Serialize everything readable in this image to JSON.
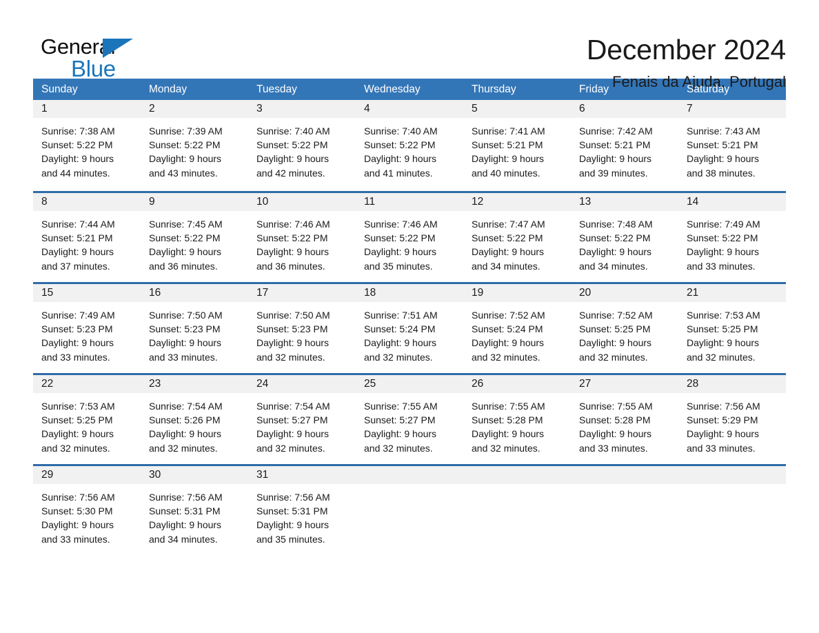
{
  "brand": {
    "logo_primary": "General",
    "logo_secondary": "Blue",
    "logo_mark": "triangle-icon",
    "accent_color": "#1b75bb"
  },
  "header": {
    "title": "December 2024",
    "subtitle": "Fenais da Ajuda, Portugal"
  },
  "colors": {
    "header_bar": "#3376b8",
    "row_divider": "#2e6ca8",
    "day_band": "#f1f1f1",
    "text": "#1a1a1a"
  },
  "weekday_headers": [
    "Sunday",
    "Monday",
    "Tuesday",
    "Wednesday",
    "Thursday",
    "Friday",
    "Saturday"
  ],
  "weeks": [
    [
      {
        "day": "1",
        "sunrise": "Sunrise: 7:38 AM",
        "sunset": "Sunset: 5:22 PM",
        "daylight1": "Daylight: 9 hours",
        "daylight2": "and 44 minutes."
      },
      {
        "day": "2",
        "sunrise": "Sunrise: 7:39 AM",
        "sunset": "Sunset: 5:22 PM",
        "daylight1": "Daylight: 9 hours",
        "daylight2": "and 43 minutes."
      },
      {
        "day": "3",
        "sunrise": "Sunrise: 7:40 AM",
        "sunset": "Sunset: 5:22 PM",
        "daylight1": "Daylight: 9 hours",
        "daylight2": "and 42 minutes."
      },
      {
        "day": "4",
        "sunrise": "Sunrise: 7:40 AM",
        "sunset": "Sunset: 5:22 PM",
        "daylight1": "Daylight: 9 hours",
        "daylight2": "and 41 minutes."
      },
      {
        "day": "5",
        "sunrise": "Sunrise: 7:41 AM",
        "sunset": "Sunset: 5:21 PM",
        "daylight1": "Daylight: 9 hours",
        "daylight2": "and 40 minutes."
      },
      {
        "day": "6",
        "sunrise": "Sunrise: 7:42 AM",
        "sunset": "Sunset: 5:21 PM",
        "daylight1": "Daylight: 9 hours",
        "daylight2": "and 39 minutes."
      },
      {
        "day": "7",
        "sunrise": "Sunrise: 7:43 AM",
        "sunset": "Sunset: 5:21 PM",
        "daylight1": "Daylight: 9 hours",
        "daylight2": "and 38 minutes."
      }
    ],
    [
      {
        "day": "8",
        "sunrise": "Sunrise: 7:44 AM",
        "sunset": "Sunset: 5:21 PM",
        "daylight1": "Daylight: 9 hours",
        "daylight2": "and 37 minutes."
      },
      {
        "day": "9",
        "sunrise": "Sunrise: 7:45 AM",
        "sunset": "Sunset: 5:22 PM",
        "daylight1": "Daylight: 9 hours",
        "daylight2": "and 36 minutes."
      },
      {
        "day": "10",
        "sunrise": "Sunrise: 7:46 AM",
        "sunset": "Sunset: 5:22 PM",
        "daylight1": "Daylight: 9 hours",
        "daylight2": "and 36 minutes."
      },
      {
        "day": "11",
        "sunrise": "Sunrise: 7:46 AM",
        "sunset": "Sunset: 5:22 PM",
        "daylight1": "Daylight: 9 hours",
        "daylight2": "and 35 minutes."
      },
      {
        "day": "12",
        "sunrise": "Sunrise: 7:47 AM",
        "sunset": "Sunset: 5:22 PM",
        "daylight1": "Daylight: 9 hours",
        "daylight2": "and 34 minutes."
      },
      {
        "day": "13",
        "sunrise": "Sunrise: 7:48 AM",
        "sunset": "Sunset: 5:22 PM",
        "daylight1": "Daylight: 9 hours",
        "daylight2": "and 34 minutes."
      },
      {
        "day": "14",
        "sunrise": "Sunrise: 7:49 AM",
        "sunset": "Sunset: 5:22 PM",
        "daylight1": "Daylight: 9 hours",
        "daylight2": "and 33 minutes."
      }
    ],
    [
      {
        "day": "15",
        "sunrise": "Sunrise: 7:49 AM",
        "sunset": "Sunset: 5:23 PM",
        "daylight1": "Daylight: 9 hours",
        "daylight2": "and 33 minutes."
      },
      {
        "day": "16",
        "sunrise": "Sunrise: 7:50 AM",
        "sunset": "Sunset: 5:23 PM",
        "daylight1": "Daylight: 9 hours",
        "daylight2": "and 33 minutes."
      },
      {
        "day": "17",
        "sunrise": "Sunrise: 7:50 AM",
        "sunset": "Sunset: 5:23 PM",
        "daylight1": "Daylight: 9 hours",
        "daylight2": "and 32 minutes."
      },
      {
        "day": "18",
        "sunrise": "Sunrise: 7:51 AM",
        "sunset": "Sunset: 5:24 PM",
        "daylight1": "Daylight: 9 hours",
        "daylight2": "and 32 minutes."
      },
      {
        "day": "19",
        "sunrise": "Sunrise: 7:52 AM",
        "sunset": "Sunset: 5:24 PM",
        "daylight1": "Daylight: 9 hours",
        "daylight2": "and 32 minutes."
      },
      {
        "day": "20",
        "sunrise": "Sunrise: 7:52 AM",
        "sunset": "Sunset: 5:25 PM",
        "daylight1": "Daylight: 9 hours",
        "daylight2": "and 32 minutes."
      },
      {
        "day": "21",
        "sunrise": "Sunrise: 7:53 AM",
        "sunset": "Sunset: 5:25 PM",
        "daylight1": "Daylight: 9 hours",
        "daylight2": "and 32 minutes."
      }
    ],
    [
      {
        "day": "22",
        "sunrise": "Sunrise: 7:53 AM",
        "sunset": "Sunset: 5:25 PM",
        "daylight1": "Daylight: 9 hours",
        "daylight2": "and 32 minutes."
      },
      {
        "day": "23",
        "sunrise": "Sunrise: 7:54 AM",
        "sunset": "Sunset: 5:26 PM",
        "daylight1": "Daylight: 9 hours",
        "daylight2": "and 32 minutes."
      },
      {
        "day": "24",
        "sunrise": "Sunrise: 7:54 AM",
        "sunset": "Sunset: 5:27 PM",
        "daylight1": "Daylight: 9 hours",
        "daylight2": "and 32 minutes."
      },
      {
        "day": "25",
        "sunrise": "Sunrise: 7:55 AM",
        "sunset": "Sunset: 5:27 PM",
        "daylight1": "Daylight: 9 hours",
        "daylight2": "and 32 minutes."
      },
      {
        "day": "26",
        "sunrise": "Sunrise: 7:55 AM",
        "sunset": "Sunset: 5:28 PM",
        "daylight1": "Daylight: 9 hours",
        "daylight2": "and 32 minutes."
      },
      {
        "day": "27",
        "sunrise": "Sunrise: 7:55 AM",
        "sunset": "Sunset: 5:28 PM",
        "daylight1": "Daylight: 9 hours",
        "daylight2": "and 33 minutes."
      },
      {
        "day": "28",
        "sunrise": "Sunrise: 7:56 AM",
        "sunset": "Sunset: 5:29 PM",
        "daylight1": "Daylight: 9 hours",
        "daylight2": "and 33 minutes."
      }
    ],
    [
      {
        "day": "29",
        "sunrise": "Sunrise: 7:56 AM",
        "sunset": "Sunset: 5:30 PM",
        "daylight1": "Daylight: 9 hours",
        "daylight2": "and 33 minutes."
      },
      {
        "day": "30",
        "sunrise": "Sunrise: 7:56 AM",
        "sunset": "Sunset: 5:31 PM",
        "daylight1": "Daylight: 9 hours",
        "daylight2": "and 34 minutes."
      },
      {
        "day": "31",
        "sunrise": "Sunrise: 7:56 AM",
        "sunset": "Sunset: 5:31 PM",
        "daylight1": "Daylight: 9 hours",
        "daylight2": "and 35 minutes."
      },
      {
        "day": "",
        "sunrise": "",
        "sunset": "",
        "daylight1": "",
        "daylight2": ""
      },
      {
        "day": "",
        "sunrise": "",
        "sunset": "",
        "daylight1": "",
        "daylight2": ""
      },
      {
        "day": "",
        "sunrise": "",
        "sunset": "",
        "daylight1": "",
        "daylight2": ""
      },
      {
        "day": "",
        "sunrise": "",
        "sunset": "",
        "daylight1": "",
        "daylight2": ""
      }
    ]
  ]
}
